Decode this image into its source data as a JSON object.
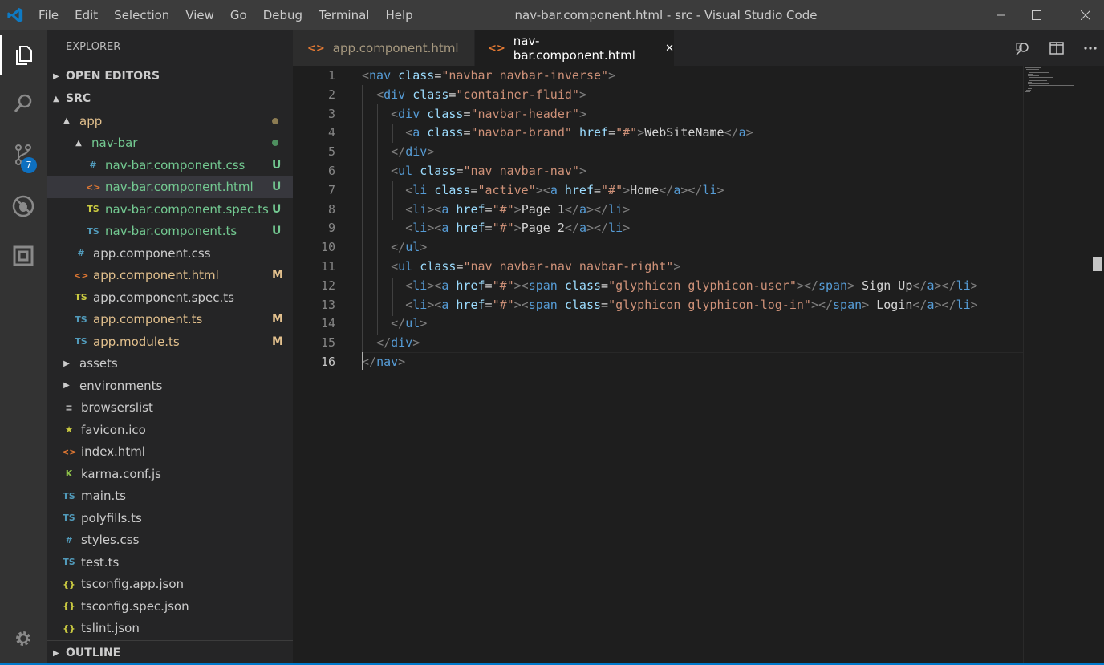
{
  "menu": [
    "File",
    "Edit",
    "Selection",
    "View",
    "Go",
    "Debug",
    "Terminal",
    "Help"
  ],
  "window_title": "nav-bar.component.html - src - Visual Studio Code",
  "activity": {
    "scm_badge": "7"
  },
  "explorer": {
    "title": "EXPLORER",
    "open_editors": "OPEN EDITORS",
    "src": "SRC",
    "outline": "OUTLINE",
    "tree": [
      {
        "label": "app",
        "arrow": "▲",
        "icon": "",
        "indent": 1,
        "color": "#e2c08d",
        "status": "",
        "dot": "#8c7c52"
      },
      {
        "label": "nav-bar",
        "arrow": "▲",
        "icon": "",
        "indent": 2,
        "color": "#73c991",
        "status": "",
        "dot": "#4e8f5f"
      },
      {
        "label": "nav-bar.component.css",
        "icon": "#",
        "iconColor": "#519aba",
        "indent": 3,
        "color": "#73c991",
        "status": "U",
        "statusColor": "#73c991"
      },
      {
        "label": "nav-bar.component.html",
        "icon": "<>",
        "iconColor": "#e37933",
        "indent": 3,
        "color": "#73c991",
        "status": "U",
        "statusColor": "#73c991",
        "selected": true
      },
      {
        "label": "nav-bar.component.spec.ts",
        "icon": "TS",
        "iconColor": "#cbcb41",
        "indent": 3,
        "color": "#73c991",
        "status": "U",
        "statusColor": "#73c991"
      },
      {
        "label": "nav-bar.component.ts",
        "icon": "TS",
        "iconColor": "#519aba",
        "indent": 3,
        "color": "#73c991",
        "status": "U",
        "statusColor": "#73c991"
      },
      {
        "label": "app.component.css",
        "icon": "#",
        "iconColor": "#519aba",
        "indent": 2,
        "color": "#cccccc",
        "status": ""
      },
      {
        "label": "app.component.html",
        "icon": "<>",
        "iconColor": "#e37933",
        "indent": 2,
        "color": "#e2c08d",
        "status": "M",
        "statusColor": "#e2c08d"
      },
      {
        "label": "app.component.spec.ts",
        "icon": "TS",
        "iconColor": "#cbcb41",
        "indent": 2,
        "color": "#cccccc",
        "status": ""
      },
      {
        "label": "app.component.ts",
        "icon": "TS",
        "iconColor": "#519aba",
        "indent": 2,
        "color": "#e2c08d",
        "status": "M",
        "statusColor": "#e2c08d"
      },
      {
        "label": "app.module.ts",
        "icon": "TS",
        "iconColor": "#519aba",
        "indent": 2,
        "color": "#e2c08d",
        "status": "M",
        "statusColor": "#e2c08d"
      },
      {
        "label": "assets",
        "arrow": "▶",
        "icon": "",
        "indent": 1,
        "color": "#cccccc",
        "status": ""
      },
      {
        "label": "environments",
        "arrow": "▶",
        "icon": "",
        "indent": 1,
        "color": "#cccccc",
        "status": ""
      },
      {
        "label": "browserslist",
        "icon": "≡",
        "iconColor": "#cccccc",
        "indent": 1,
        "color": "#cccccc",
        "status": ""
      },
      {
        "label": "favicon.ico",
        "icon": "★",
        "iconColor": "#cbcb41",
        "indent": 1,
        "color": "#cccccc",
        "status": ""
      },
      {
        "label": "index.html",
        "icon": "<>",
        "iconColor": "#e37933",
        "indent": 1,
        "color": "#cccccc",
        "status": ""
      },
      {
        "label": "karma.conf.js",
        "icon": "K",
        "iconColor": "#8dc149",
        "indent": 1,
        "color": "#cccccc",
        "status": ""
      },
      {
        "label": "main.ts",
        "icon": "TS",
        "iconColor": "#519aba",
        "indent": 1,
        "color": "#cccccc",
        "status": ""
      },
      {
        "label": "polyfills.ts",
        "icon": "TS",
        "iconColor": "#519aba",
        "indent": 1,
        "color": "#cccccc",
        "status": ""
      },
      {
        "label": "styles.css",
        "icon": "#",
        "iconColor": "#519aba",
        "indent": 1,
        "color": "#cccccc",
        "status": ""
      },
      {
        "label": "test.ts",
        "icon": "TS",
        "iconColor": "#519aba",
        "indent": 1,
        "color": "#cccccc",
        "status": ""
      },
      {
        "label": "tsconfig.app.json",
        "icon": "{}",
        "iconColor": "#cbcb41",
        "indent": 1,
        "color": "#cccccc",
        "status": ""
      },
      {
        "label": "tsconfig.spec.json",
        "icon": "{}",
        "iconColor": "#cbcb41",
        "indent": 1,
        "color": "#cccccc",
        "status": ""
      },
      {
        "label": "tslint.json",
        "icon": "{}",
        "iconColor": "#cbcb41",
        "indent": 1,
        "color": "#cccccc",
        "status": ""
      }
    ]
  },
  "tabs": [
    {
      "label": "app.component.html",
      "icon": "<>",
      "active": false,
      "color": "#e2c08d"
    },
    {
      "label": "nav-bar.component.html",
      "icon": "<>",
      "active": true,
      "close": "✕"
    }
  ],
  "editor": {
    "lines": [
      [
        [
          "p",
          "<"
        ],
        [
          "t",
          "nav"
        ],
        [
          "x",
          " "
        ],
        [
          "a",
          "class"
        ],
        [
          "x",
          "="
        ],
        [
          "s",
          "\"navbar navbar-inverse\""
        ],
        [
          "p",
          ">"
        ]
      ],
      [
        [
          "x",
          "  "
        ],
        [
          "p",
          "<"
        ],
        [
          "t",
          "div"
        ],
        [
          "x",
          " "
        ],
        [
          "a",
          "class"
        ],
        [
          "x",
          "="
        ],
        [
          "s",
          "\"container-fluid\""
        ],
        [
          "p",
          ">"
        ]
      ],
      [
        [
          "x",
          "    "
        ],
        [
          "p",
          "<"
        ],
        [
          "t",
          "div"
        ],
        [
          "x",
          " "
        ],
        [
          "a",
          "class"
        ],
        [
          "x",
          "="
        ],
        [
          "s",
          "\"navbar-header\""
        ],
        [
          "p",
          ">"
        ]
      ],
      [
        [
          "x",
          "      "
        ],
        [
          "p",
          "<"
        ],
        [
          "t",
          "a"
        ],
        [
          "x",
          " "
        ],
        [
          "a",
          "class"
        ],
        [
          "x",
          "="
        ],
        [
          "s",
          "\"navbar-brand\""
        ],
        [
          "x",
          " "
        ],
        [
          "a",
          "href"
        ],
        [
          "x",
          "="
        ],
        [
          "s",
          "\"#\""
        ],
        [
          "p",
          ">"
        ],
        [
          "x",
          "WebSiteName"
        ],
        [
          "p",
          "</"
        ],
        [
          "t",
          "a"
        ],
        [
          "p",
          ">"
        ]
      ],
      [
        [
          "x",
          "    "
        ],
        [
          "p",
          "</"
        ],
        [
          "t",
          "div"
        ],
        [
          "p",
          ">"
        ]
      ],
      [
        [
          "x",
          "    "
        ],
        [
          "p",
          "<"
        ],
        [
          "t",
          "ul"
        ],
        [
          "x",
          " "
        ],
        [
          "a",
          "class"
        ],
        [
          "x",
          "="
        ],
        [
          "s",
          "\"nav navbar-nav\""
        ],
        [
          "p",
          ">"
        ]
      ],
      [
        [
          "x",
          "      "
        ],
        [
          "p",
          "<"
        ],
        [
          "t",
          "li"
        ],
        [
          "x",
          " "
        ],
        [
          "a",
          "class"
        ],
        [
          "x",
          "="
        ],
        [
          "s",
          "\"active\""
        ],
        [
          "p",
          "><"
        ],
        [
          "t",
          "a"
        ],
        [
          "x",
          " "
        ],
        [
          "a",
          "href"
        ],
        [
          "x",
          "="
        ],
        [
          "s",
          "\"#\""
        ],
        [
          "p",
          ">"
        ],
        [
          "x",
          "Home"
        ],
        [
          "p",
          "</"
        ],
        [
          "t",
          "a"
        ],
        [
          "p",
          "></"
        ],
        [
          "t",
          "li"
        ],
        [
          "p",
          ">"
        ]
      ],
      [
        [
          "x",
          "      "
        ],
        [
          "p",
          "<"
        ],
        [
          "t",
          "li"
        ],
        [
          "p",
          "><"
        ],
        [
          "t",
          "a"
        ],
        [
          "x",
          " "
        ],
        [
          "a",
          "href"
        ],
        [
          "x",
          "="
        ],
        [
          "s",
          "\"#\""
        ],
        [
          "p",
          ">"
        ],
        [
          "x",
          "Page 1"
        ],
        [
          "p",
          "</"
        ],
        [
          "t",
          "a"
        ],
        [
          "p",
          "></"
        ],
        [
          "t",
          "li"
        ],
        [
          "p",
          ">"
        ]
      ],
      [
        [
          "x",
          "      "
        ],
        [
          "p",
          "<"
        ],
        [
          "t",
          "li"
        ],
        [
          "p",
          "><"
        ],
        [
          "t",
          "a"
        ],
        [
          "x",
          " "
        ],
        [
          "a",
          "href"
        ],
        [
          "x",
          "="
        ],
        [
          "s",
          "\"#\""
        ],
        [
          "p",
          ">"
        ],
        [
          "x",
          "Page 2"
        ],
        [
          "p",
          "</"
        ],
        [
          "t",
          "a"
        ],
        [
          "p",
          "></"
        ],
        [
          "t",
          "li"
        ],
        [
          "p",
          ">"
        ]
      ],
      [
        [
          "x",
          "    "
        ],
        [
          "p",
          "</"
        ],
        [
          "t",
          "ul"
        ],
        [
          "p",
          ">"
        ]
      ],
      [
        [
          "x",
          "    "
        ],
        [
          "p",
          "<"
        ],
        [
          "t",
          "ul"
        ],
        [
          "x",
          " "
        ],
        [
          "a",
          "class"
        ],
        [
          "x",
          "="
        ],
        [
          "s",
          "\"nav navbar-nav navbar-right\""
        ],
        [
          "p",
          ">"
        ]
      ],
      [
        [
          "x",
          "      "
        ],
        [
          "p",
          "<"
        ],
        [
          "t",
          "li"
        ],
        [
          "p",
          "><"
        ],
        [
          "t",
          "a"
        ],
        [
          "x",
          " "
        ],
        [
          "a",
          "href"
        ],
        [
          "x",
          "="
        ],
        [
          "s",
          "\"#\""
        ],
        [
          "p",
          "><"
        ],
        [
          "t",
          "span"
        ],
        [
          "x",
          " "
        ],
        [
          "a",
          "class"
        ],
        [
          "x",
          "="
        ],
        [
          "s",
          "\"glyphicon glyphicon-user\""
        ],
        [
          "p",
          "></"
        ],
        [
          "t",
          "span"
        ],
        [
          "p",
          ">"
        ],
        [
          "x",
          " Sign Up"
        ],
        [
          "p",
          "</"
        ],
        [
          "t",
          "a"
        ],
        [
          "p",
          "></"
        ],
        [
          "t",
          "li"
        ],
        [
          "p",
          ">"
        ]
      ],
      [
        [
          "x",
          "      "
        ],
        [
          "p",
          "<"
        ],
        [
          "t",
          "li"
        ],
        [
          "p",
          "><"
        ],
        [
          "t",
          "a"
        ],
        [
          "x",
          " "
        ],
        [
          "a",
          "href"
        ],
        [
          "x",
          "="
        ],
        [
          "s",
          "\"#\""
        ],
        [
          "p",
          "><"
        ],
        [
          "t",
          "span"
        ],
        [
          "x",
          " "
        ],
        [
          "a",
          "class"
        ],
        [
          "x",
          "="
        ],
        [
          "s",
          "\"glyphicon glyphicon-log-in\""
        ],
        [
          "p",
          "></"
        ],
        [
          "t",
          "span"
        ],
        [
          "p",
          ">"
        ],
        [
          "x",
          " Login"
        ],
        [
          "p",
          "</"
        ],
        [
          "t",
          "a"
        ],
        [
          "p",
          "></"
        ],
        [
          "t",
          "li"
        ],
        [
          "p",
          ">"
        ]
      ],
      [
        [
          "x",
          "    "
        ],
        [
          "p",
          "</"
        ],
        [
          "t",
          "ul"
        ],
        [
          "p",
          ">"
        ]
      ],
      [
        [
          "x",
          "  "
        ],
        [
          "p",
          "</"
        ],
        [
          "t",
          "div"
        ],
        [
          "p",
          ">"
        ]
      ],
      [
        [
          "p",
          "</"
        ],
        [
          "t",
          "nav"
        ],
        [
          "p",
          ">"
        ]
      ]
    ],
    "current_line": 16
  }
}
